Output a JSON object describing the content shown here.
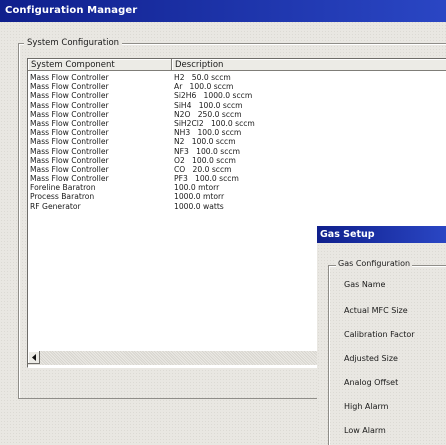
{
  "window": {
    "title": "Configuration Manager"
  },
  "system_config": {
    "group_label": "System Configuration",
    "columns": [
      "System Component",
      "Description"
    ],
    "rows": [
      {
        "component": "Mass Flow Controller",
        "description": "H2   50.0 sccm"
      },
      {
        "component": "Mass Flow Controller",
        "description": "Ar   100.0 sccm"
      },
      {
        "component": "Mass Flow Controller",
        "description": "Si2H6   1000.0 sccm"
      },
      {
        "component": "Mass Flow Controller",
        "description": "SiH4   100.0 sccm"
      },
      {
        "component": "Mass Flow Controller",
        "description": "N2O   250.0 sccm"
      },
      {
        "component": "Mass Flow Controller",
        "description": "SiH2Cl2   100.0 sccm"
      },
      {
        "component": "Mass Flow Controller",
        "description": "NH3   100.0 sccm"
      },
      {
        "component": "Mass Flow Controller",
        "description": "N2   100.0 sccm"
      },
      {
        "component": "Mass Flow Controller",
        "description": "NF3   100.0 sccm"
      },
      {
        "component": "Mass Flow Controller",
        "description": "O2   100.0 sccm"
      },
      {
        "component": "Mass Flow Controller",
        "description": "CO   20.0 sccm"
      },
      {
        "component": "Mass Flow Controller",
        "description": "PF3   100.0 sccm"
      },
      {
        "component": "Foreline Baratron",
        "description": "100.0 mtorr"
      },
      {
        "component": "Process Baratron",
        "description": "1000.0 mtorr"
      },
      {
        "component": "RF Generator",
        "description": "1000.0 watts"
      }
    ],
    "scroll_left_icon": "left-arrow-icon"
  },
  "gas_setup": {
    "title": "Gas Setup",
    "group_label": "Gas Configuration",
    "fields": [
      "Gas Name",
      "Actual MFC Size",
      "Calibration Factor",
      "Adjusted Size",
      "Analog Offset",
      "High Alarm",
      "Low Alarm"
    ]
  },
  "colors": {
    "titlebar_start": "#0f1f8c",
    "titlebar_end": "#2a46c4",
    "background": "#e9e7e2",
    "list_background": "#ffffff"
  }
}
